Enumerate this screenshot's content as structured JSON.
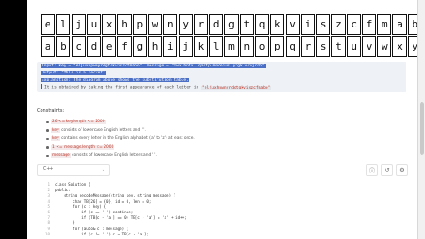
{
  "cipher_table": {
    "row_top": [
      "e",
      "l",
      "j",
      "u",
      "x",
      "h",
      "p",
      "w",
      "n",
      "y",
      "r",
      "d",
      "g",
      "t",
      "q",
      "k",
      "v",
      "i",
      "s",
      "z",
      "c",
      "f",
      "m",
      "a",
      "b",
      "o"
    ],
    "row_bottom": [
      "a",
      "b",
      "c",
      "d",
      "e",
      "f",
      "g",
      "h",
      "i",
      "j",
      "k",
      "l",
      "m",
      "n",
      "o",
      "p",
      "q",
      "r",
      "s",
      "t",
      "u",
      "v",
      "w",
      "x",
      "y",
      "z"
    ]
  },
  "example": {
    "input_line": "Input: key = \"eljuxhpwnyrdgtqkviszcfmabo\", message = \"zwx hnfx lqantp mnoeius ycgk vcnjrdb\"",
    "output_line": "Output: \"this is a secret\"",
    "explanation_line": "Explanation: The diagram above shows the substitution table.",
    "detail_prefix": "It is obtained by taking the first appearance of each letter in ",
    "detail_code": "\"eljuxhpwnyrdgtqkviszcfmabo\""
  },
  "constraints": {
    "title": "Constraints:",
    "items": [
      {
        "code": "26 <= key.length <= 2000",
        "text": ""
      },
      {
        "code": "key",
        "text": " consists of lowercase English letters and ' '."
      },
      {
        "code": "key",
        "text": " contains every letter in the English alphabet ('a' to 'z') at least once."
      },
      {
        "code": "1 <= message.length <= 2000",
        "text": ""
      },
      {
        "code": "message",
        "text": " consists of lowercase English letters and ' '."
      }
    ]
  },
  "editor": {
    "language": "C++",
    "tools": [
      "info-icon",
      "reset-icon",
      "settings-icon"
    ]
  },
  "code": [
    {
      "n": "1",
      "text": "class Solution {"
    },
    {
      "n": "2",
      "text": "public:"
    },
    {
      "n": "3",
      "text": "    string decodeMessage(string key, string message) {"
    },
    {
      "n": "4",
      "text": "        char TB[26] = {0}, id = 0, len = 0;"
    },
    {
      "n": "5",
      "text": "        for (c : key) {"
    },
    {
      "n": "6",
      "text": "            if (c == ' ') continue;"
    },
    {
      "n": "7",
      "text": "            if (TB[c - 'a'] == 0) TB[c - 'a'] = 'a' + id++;"
    },
    {
      "n": "8",
      "text": "        }"
    },
    {
      "n": "9",
      "text": "        for (auto& c : message) {"
    },
    {
      "n": "10",
      "text": "            if (c != ' ') c = TB[c - 'a'];"
    }
  ]
}
